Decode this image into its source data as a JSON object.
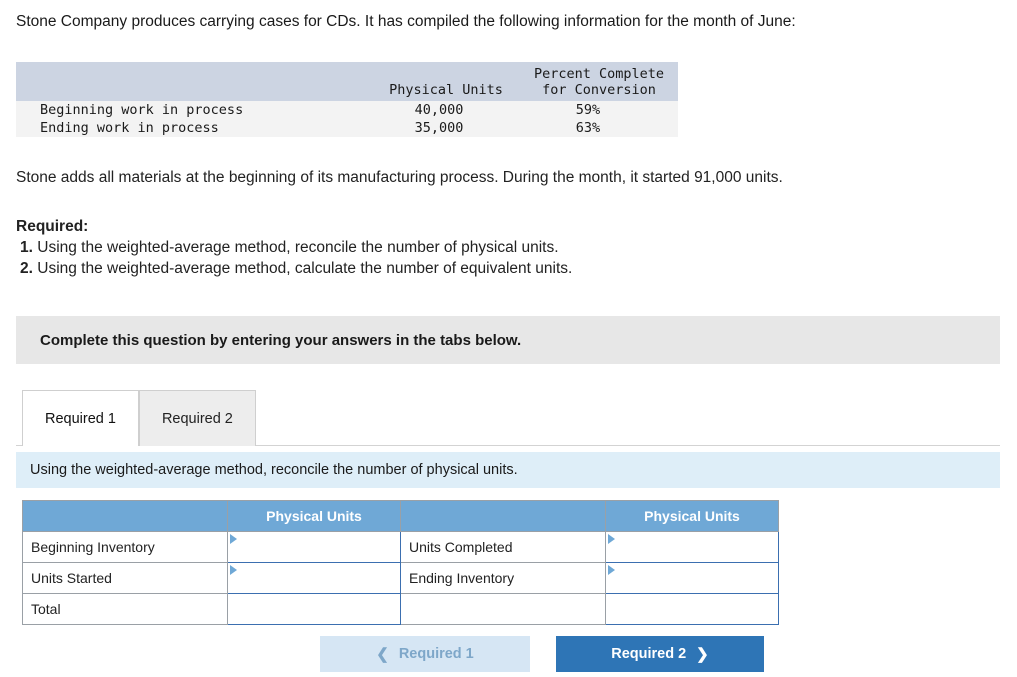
{
  "intro": "Stone Company produces carrying cases for CDs. It has compiled the following information for the month of June:",
  "info_table": {
    "headers": [
      "",
      "Physical Units",
      "Percent Complete for Conversion"
    ],
    "header_line1": [
      "",
      "",
      "Percent Complete"
    ],
    "header_line2": [
      "",
      "Physical Units",
      "for Conversion"
    ],
    "rows": [
      {
        "label": "Beginning work in process",
        "units": "40,000",
        "percent": "59%"
      },
      {
        "label": "Ending work in process",
        "units": "35,000",
        "percent": "63%"
      }
    ]
  },
  "paragraph2": "Stone adds all materials at the beginning of its manufacturing process. During the month, it started 91,000 units.",
  "required": {
    "heading": "Required:",
    "items": [
      {
        "num": "1.",
        "text": "Using the weighted-average method, reconcile the number of physical units."
      },
      {
        "num": "2.",
        "text": "Using the weighted-average method, calculate the number of equivalent units."
      }
    ]
  },
  "complete_bar": "Complete this question by entering your answers in the tabs below.",
  "tabs": [
    {
      "label": "Required 1",
      "active": true
    },
    {
      "label": "Required 2",
      "active": false
    }
  ],
  "blue_strip": "Using the weighted-average method, reconcile the number of physical units.",
  "answer_grid": {
    "headers": [
      "",
      "Physical Units",
      "",
      "Physical Units"
    ],
    "rows": [
      {
        "left_label": "Beginning Inventory",
        "left_value": "",
        "right_label": "Units Completed",
        "right_value": ""
      },
      {
        "left_label": "Units Started",
        "left_value": "",
        "right_label": "Ending Inventory",
        "right_value": ""
      },
      {
        "left_label": "Total",
        "left_value": "",
        "right_label": "",
        "right_value": ""
      }
    ]
  },
  "nav": {
    "prev_label": "Required 1",
    "next_label": "Required 2",
    "prev_icon": "chevron-left-icon",
    "next_icon": "chevron-right-icon"
  },
  "colors": {
    "table_header_bg": "#ccd4e2",
    "grid_header_bg": "#6fa8d6",
    "blue_strip_bg": "#deeef8",
    "grey_bar_bg": "#e7e7e7",
    "next_btn_bg": "#2e75b6",
    "prev_btn_bg": "#d6e6f4"
  }
}
